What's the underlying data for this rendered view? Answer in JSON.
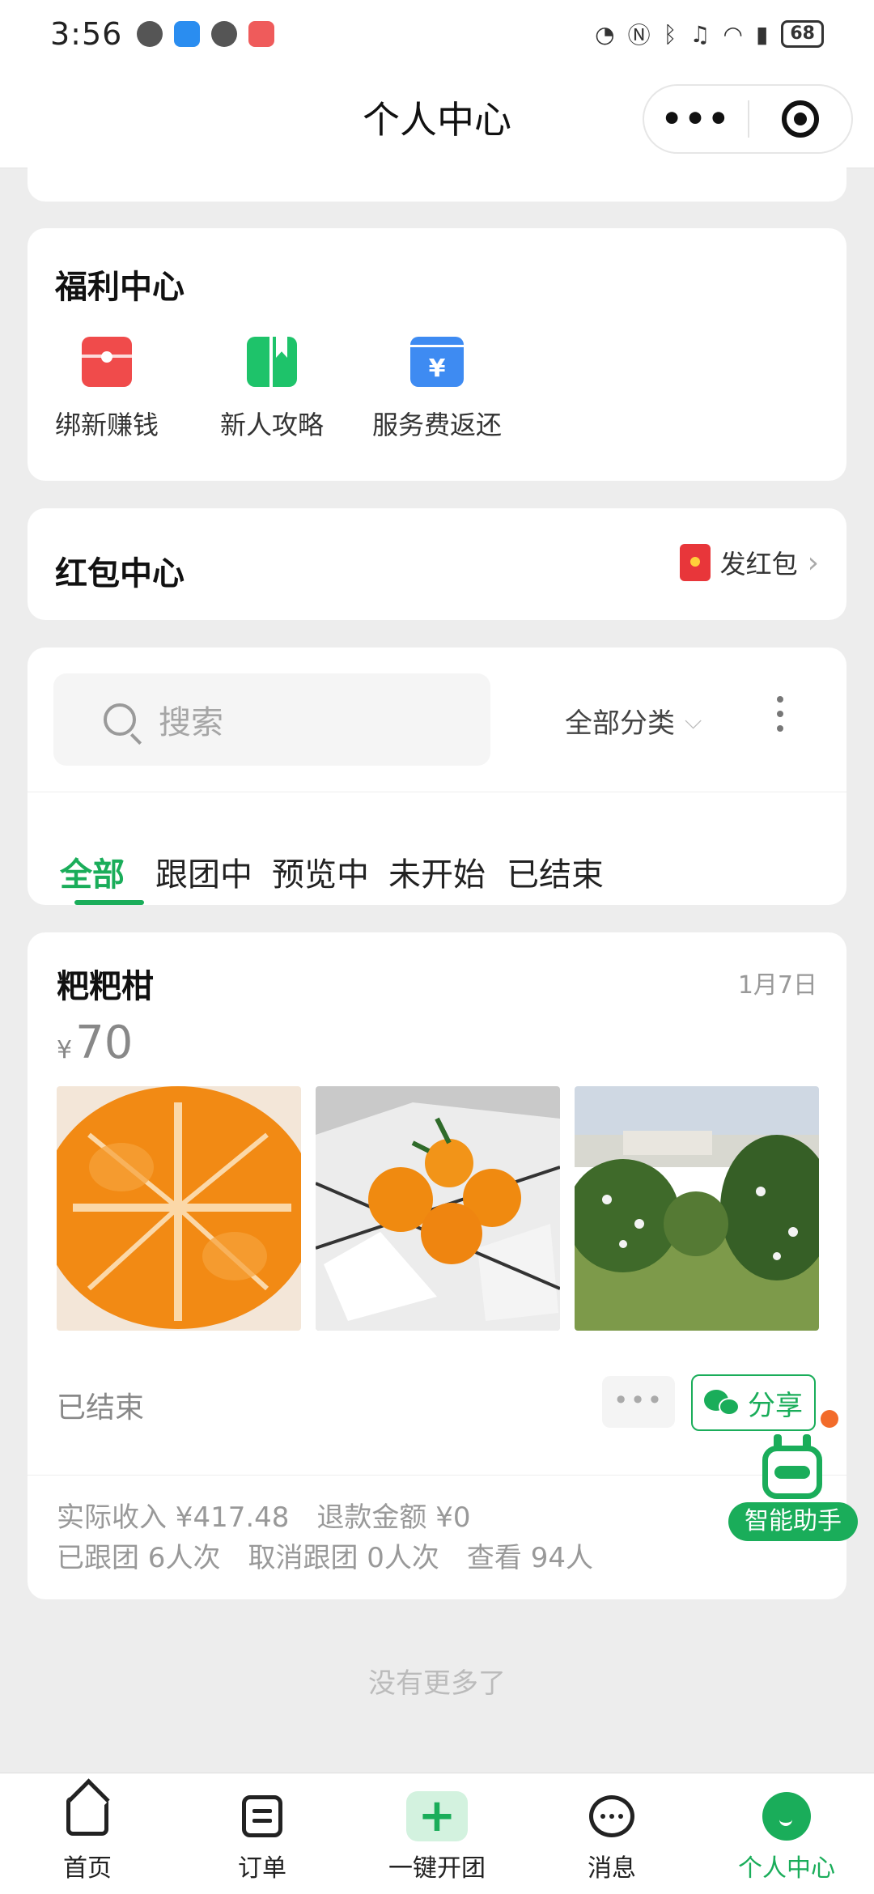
{
  "status_bar": {
    "time": "3:56",
    "battery": "68",
    "right_icons": [
      "data-speed-icon",
      "nfc-icon",
      "bluetooth-icon",
      "mute-icon",
      "wifi-icon",
      "signal-4g-icon",
      "battery-icon"
    ]
  },
  "navbar": {
    "title": "个人中心",
    "capsule_more": "•••"
  },
  "welfare": {
    "title": "福利中心",
    "items": [
      {
        "label": "绑新赚钱",
        "icon": "red-envelope-icon",
        "color": "#f04b4b"
      },
      {
        "label": "新人攻略",
        "icon": "guide-book-icon",
        "color": "#1ec36a"
      },
      {
        "label": "服务费返还",
        "icon": "yen-refund-icon",
        "color": "#3e8bf2"
      }
    ],
    "refund_symbol": "¥"
  },
  "redpacket": {
    "title": "红包中心",
    "action": "发红包",
    "chevron": "›"
  },
  "filter": {
    "search_placeholder": "搜索",
    "category": "全部分类",
    "category_caret": "⌵",
    "tabs": [
      "全部",
      "跟团中",
      "预览中",
      "未开始",
      "已结束"
    ],
    "active_tab": "全部"
  },
  "product": {
    "name": "粑粑柑",
    "date": "1月7日",
    "currency": "¥",
    "price": "70",
    "status": "已结束",
    "more_label": "•••",
    "share_label": "分享",
    "stats_row1": [
      "实际收入 ¥417.48",
      "退款金额 ¥0"
    ],
    "stats_row2": [
      "已跟团 6人次",
      "取消跟团 0人次",
      "查看 94人"
    ]
  },
  "assistant": {
    "label": "智能助手"
  },
  "footer": {
    "no_more": "没有更多了"
  },
  "tabbar": {
    "items": [
      "首页",
      "订单",
      "一键开团",
      "消息",
      "个人中心"
    ],
    "active": "个人中心",
    "open_symbol": "+"
  },
  "colors": {
    "accent": "#1aad5a",
    "background": "#ededed",
    "badge_dot": "#f26b2a"
  }
}
